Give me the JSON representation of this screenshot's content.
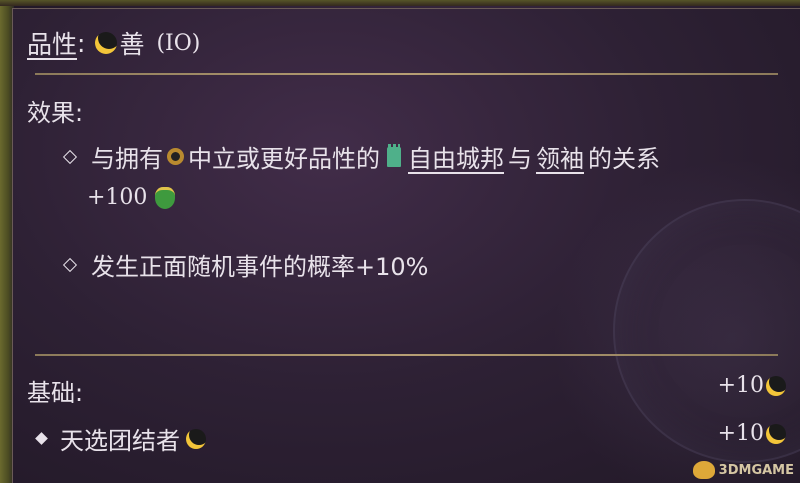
{
  "quality": {
    "label": "品性",
    "colon": ":",
    "value": "善",
    "level": "(IO)"
  },
  "effects": {
    "title": "效果:",
    "items": [
      {
        "prefix": "与拥有",
        "middle": "中立或更好品性的",
        "link1": "自由城邦",
        "join": "与",
        "link2": "领袖",
        "suffix": "的关系",
        "bonus": "+100"
      },
      {
        "text": "发生正面随机事件的概率+10%"
      }
    ]
  },
  "base": {
    "title": "基础:",
    "value": "+10"
  },
  "sources": [
    {
      "label": "天选团结者",
      "value": "+10"
    }
  ],
  "icons": {
    "good": "crescent-moon-icon",
    "neutral": "ring-icon",
    "city_state": "tower-icon",
    "leader": "leader-face-icon"
  },
  "colors": {
    "accent_gold": "#f3c53a",
    "divider": "#b79f74",
    "text": "#e8e2ea"
  },
  "watermark": "3DMGAME"
}
